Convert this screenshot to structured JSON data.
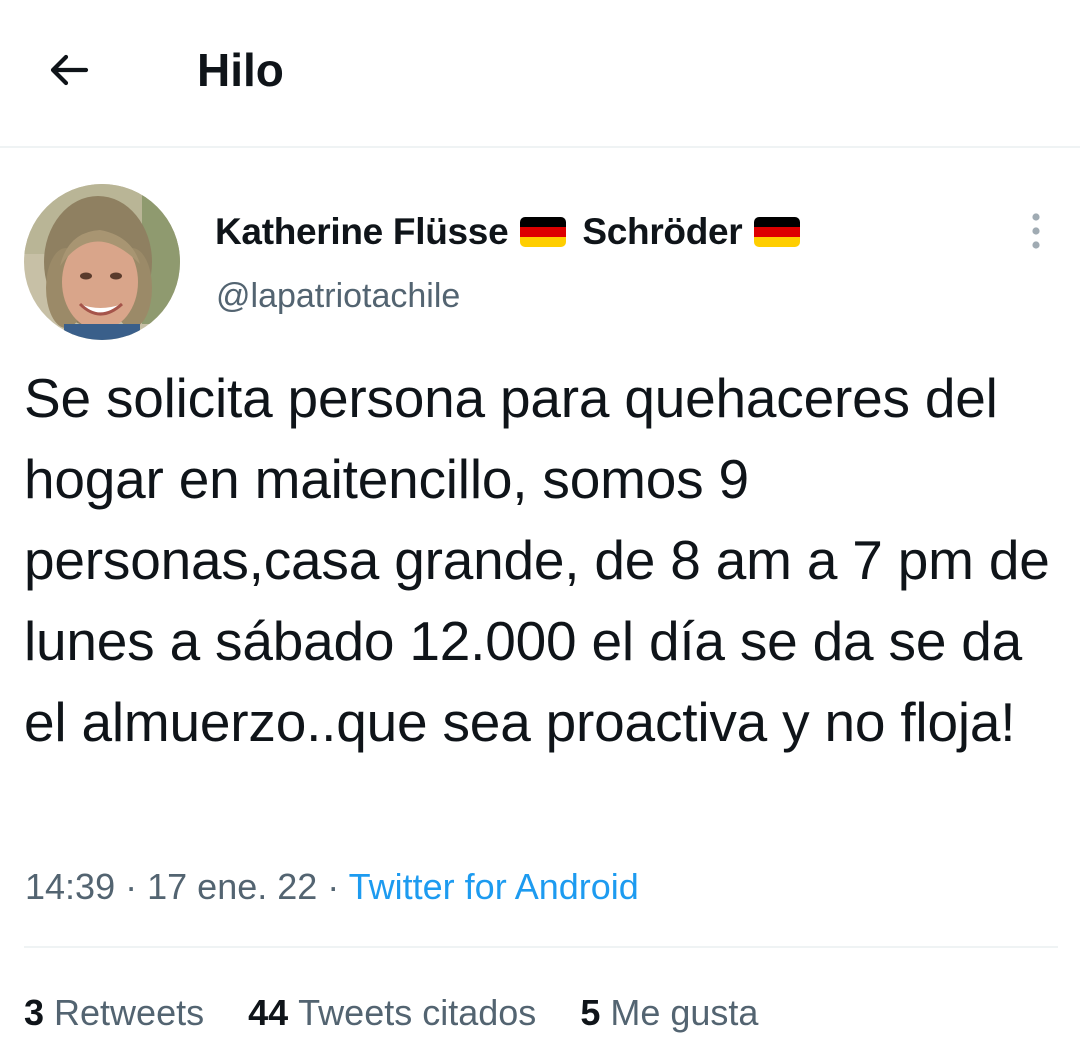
{
  "header": {
    "back_icon": "arrow-left-icon",
    "title": "Hilo"
  },
  "tweet": {
    "author": {
      "display_name_part1": "Katherine Flüsse",
      "display_name_part2": "Schröder",
      "flag_icon": "germany-flag-icon",
      "handle": "@lapatriotachile"
    },
    "more_icon": "vertical-ellipsis-icon",
    "text": "Se solicita persona para quehaceres del hogar en maitencillo, somos 9 personas,casa grande, de 8 am a 7 pm de lunes a sábado 12.000 el día se da se da el almuerzo..que sea proactiva y no floja!",
    "time": "14:39",
    "separator": "·",
    "date": "17 ene. 22",
    "source": "Twitter for Android"
  },
  "stats": {
    "retweets_count": "3",
    "retweets_label": "Retweets",
    "quotes_count": "44",
    "quotes_label": "Tweets citados",
    "likes_count": "5",
    "likes_label": "Me gusta"
  },
  "colors": {
    "text_primary": "#0f1419",
    "text_secondary": "#536471",
    "link": "#1d9bf0",
    "divider": "#eff3f4"
  }
}
